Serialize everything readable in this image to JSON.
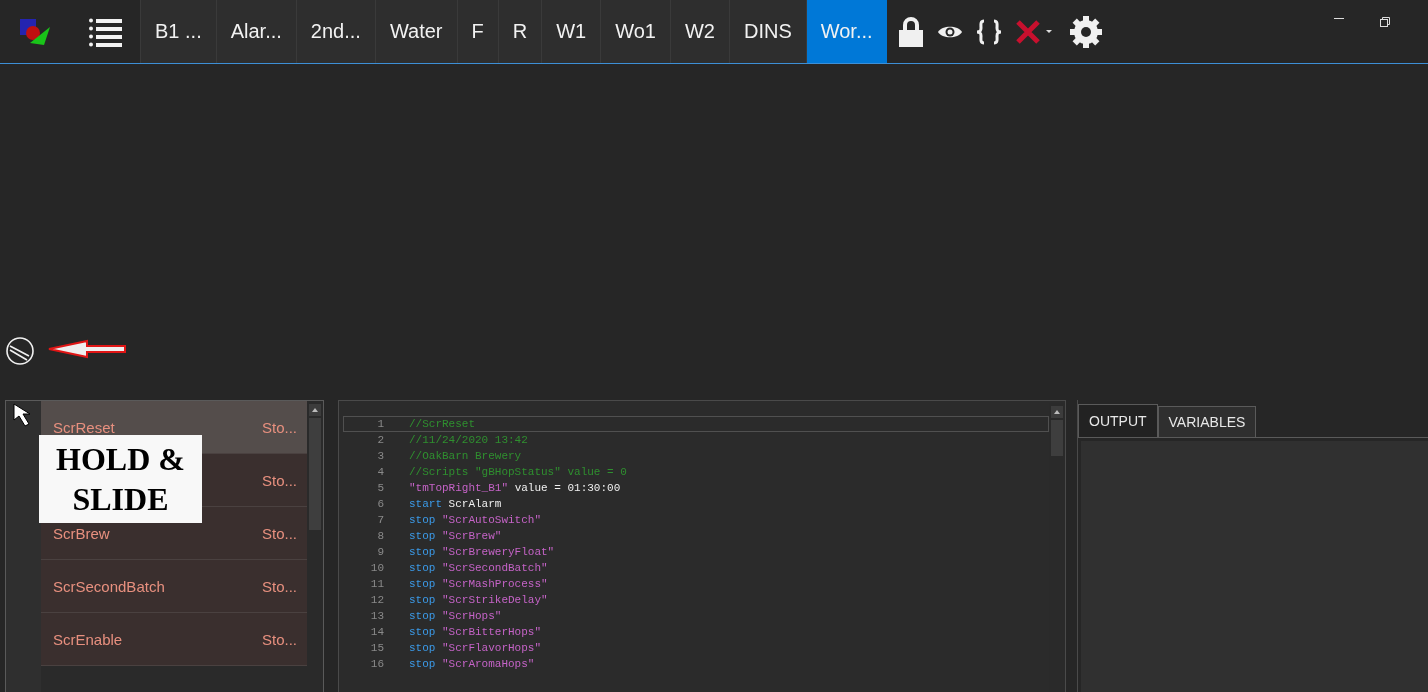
{
  "toolbar": {
    "tabs": [
      {
        "label": "B1 ...",
        "selected": false
      },
      {
        "label": "Alar...",
        "selected": false
      },
      {
        "label": "2nd...",
        "selected": false
      },
      {
        "label": "Water",
        "selected": false
      },
      {
        "label": "F",
        "selected": false
      },
      {
        "label": "R",
        "selected": false
      },
      {
        "label": "W1",
        "selected": false
      },
      {
        "label": "Wo1",
        "selected": false
      },
      {
        "label": "W2",
        "selected": false
      },
      {
        "label": "DINS",
        "selected": false
      },
      {
        "label": "Wor...",
        "selected": true
      }
    ]
  },
  "overlay": {
    "label": "HOLD &\nSLIDE"
  },
  "script_list": {
    "rows": [
      {
        "name": "ScrReset",
        "status": "Sto...",
        "selected": true
      },
      {
        "status": "Sto...",
        "selected": false
      },
      {
        "name": "ScrBrew",
        "status": "Sto...",
        "selected": false
      },
      {
        "name": "ScrSecondBatch",
        "status": "Sto...",
        "selected": false
      },
      {
        "name": "ScrEnable",
        "status": "Sto...",
        "selected": false
      }
    ]
  },
  "editor": {
    "lines": [
      {
        "number": "1",
        "current": true,
        "tokens": [
          {
            "kind": "comment",
            "text": "//ScrReset"
          }
        ]
      },
      {
        "number": "2",
        "current": false,
        "tokens": [
          {
            "kind": "comment",
            "text": "//11/24/2020 13:42"
          }
        ]
      },
      {
        "number": "3",
        "current": false,
        "tokens": [
          {
            "kind": "comment",
            "text": "//OakBarn Brewery"
          }
        ]
      },
      {
        "number": "4",
        "current": false,
        "tokens": [
          {
            "kind": "comment",
            "text": "//Scripts \"gBHopStatus\" value = 0"
          }
        ]
      },
      {
        "number": "5",
        "current": false,
        "tokens": [
          {
            "kind": "string",
            "text": "\"tmTopRight_B1\""
          },
          {
            "kind": "plain",
            "text": " value = 01:30:00"
          }
        ]
      },
      {
        "number": "6",
        "current": false,
        "tokens": [
          {
            "kind": "keyword",
            "text": "start"
          },
          {
            "kind": "plain",
            "text": " ScrAlarm"
          }
        ]
      },
      {
        "number": "7",
        "current": false,
        "tokens": [
          {
            "kind": "keyword",
            "text": "stop"
          },
          {
            "kind": "string",
            "text": " \"ScrAutoSwitch\""
          }
        ]
      },
      {
        "number": "8",
        "current": false,
        "tokens": [
          {
            "kind": "keyword",
            "text": "stop"
          },
          {
            "kind": "string",
            "text": " \"ScrBrew\""
          }
        ]
      },
      {
        "number": "9",
        "current": false,
        "tokens": [
          {
            "kind": "keyword",
            "text": "stop"
          },
          {
            "kind": "string",
            "text": " \"ScrBreweryFloat\""
          }
        ]
      },
      {
        "number": "10",
        "current": false,
        "tokens": [
          {
            "kind": "keyword",
            "text": "stop"
          },
          {
            "kind": "string",
            "text": " \"ScrSecondBatch\""
          }
        ]
      },
      {
        "number": "11",
        "current": false,
        "tokens": [
          {
            "kind": "keyword",
            "text": "stop"
          },
          {
            "kind": "string",
            "text": " \"ScrMashProcess\""
          }
        ]
      },
      {
        "number": "12",
        "current": false,
        "tokens": [
          {
            "kind": "keyword",
            "text": "stop"
          },
          {
            "kind": "string",
            "text": " \"ScrStrikeDelay\""
          }
        ]
      },
      {
        "number": "13",
        "current": false,
        "tokens": [
          {
            "kind": "keyword",
            "text": "stop"
          },
          {
            "kind": "string",
            "text": " \"ScrHops\""
          }
        ]
      },
      {
        "number": "14",
        "current": false,
        "tokens": [
          {
            "kind": "keyword",
            "text": "stop"
          },
          {
            "kind": "string",
            "text": " \"ScrBitterHops\""
          }
        ]
      },
      {
        "number": "15",
        "current": false,
        "tokens": [
          {
            "kind": "keyword",
            "text": "stop"
          },
          {
            "kind": "string",
            "text": " \"ScrFlavorHops\""
          }
        ]
      },
      {
        "number": "16",
        "current": false,
        "tokens": [
          {
            "kind": "keyword",
            "text": "stop"
          },
          {
            "kind": "string",
            "text": " \"ScrAromaHops\""
          }
        ]
      }
    ]
  },
  "output_panel": {
    "tabs": [
      {
        "label": "OUTPUT",
        "selected": true
      },
      {
        "label": "VARIABLES",
        "selected": false
      }
    ]
  }
}
